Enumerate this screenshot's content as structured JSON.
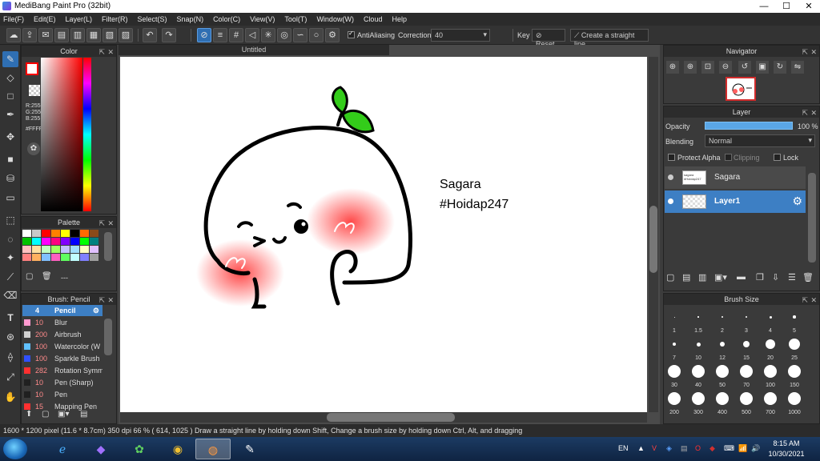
{
  "window": {
    "title": "MediBang Paint Pro (32bit)",
    "minimize": "—",
    "maximize": "☐",
    "close": "✕"
  },
  "menu": [
    "File(F)",
    "Edit(E)",
    "Layer(L)",
    "Filter(R)",
    "Select(S)",
    "Snap(N)",
    "Color(C)",
    "View(V)",
    "Tool(T)",
    "Window(W)",
    "Cloud",
    "Help"
  ],
  "toolbar": {
    "antialias_label": "AntiAliasing",
    "correction_label": "Correction",
    "correction_value": "40",
    "key_label": "Key",
    "reset_label": "Reset",
    "straight_line_label": "Create a straight line"
  },
  "color_panel": {
    "title": "Color",
    "r": "R:255",
    "g": "G:255",
    "b": "B:255",
    "hex": "#FFFFFF",
    "fg_color": "#ffffff",
    "fg_border": "#ff0000"
  },
  "palette_panel": {
    "title": "Palette",
    "dash": "---",
    "colors": [
      "#ffffff",
      "#c8c8c8",
      "#ff0000",
      "#ff8000",
      "#ffff00",
      "#000000",
      "#ff6a00",
      "#8a4a1a",
      "#00c000",
      "#00ffff",
      "#ff00ff",
      "#ff0080",
      "#8000ff",
      "#0000ff",
      "#00ff00",
      "#008080",
      "#ffc0c0",
      "#ffe0a0",
      "#c0ffc0",
      "#a0ff60",
      "#c0c0ff",
      "#a0e0ff",
      "#ffffc0",
      "#e0c0ff",
      "#ff8080",
      "#ffb060",
      "#80c0ff",
      "#ff60c0",
      "#60ff60",
      "#c0ffff",
      "#8080ff",
      "#a0a0a0"
    ]
  },
  "brush_panel": {
    "title": "Brush: Pencil",
    "items": [
      {
        "size": "4",
        "name": "Pencil",
        "color": "#3d7fc4"
      },
      {
        "size": "10",
        "name": "Blur",
        "color": "#ff9ad0"
      },
      {
        "size": "200",
        "name": "Airbrush",
        "color": "#d0d0d0"
      },
      {
        "size": "100",
        "name": "Watercolor (W",
        "color": "#60c0ff"
      },
      {
        "size": "100",
        "name": "Sparkle Brush",
        "color": "#3050ff"
      },
      {
        "size": "282",
        "name": "Rotation Symm",
        "color": "#ff3030"
      },
      {
        "size": "10",
        "name": "Pen (Sharp)",
        "color": "#202020"
      },
      {
        "size": "10",
        "name": "Pen",
        "color": "#202020"
      },
      {
        "size": "15",
        "name": "Mapping Pen",
        "color": "#ff3030"
      }
    ]
  },
  "document": {
    "tab_title": "Untitled",
    "text_line1": "Sagara",
    "text_line2": "#Hoidap247"
  },
  "navigator": {
    "title": "Navigator"
  },
  "layer_panel": {
    "title": "Layer",
    "opacity_label": "Opacity",
    "opacity_value": "100 %",
    "opacity_fraction": 1.0,
    "blending_label": "Blending",
    "blending_value": "Normal",
    "protect_alpha": "Protect Alpha",
    "clipping": "Clipping",
    "lock": "Lock",
    "layers": [
      {
        "name": "Sagara",
        "thumb_text": "sagara #Hoidap247",
        "selected": false
      },
      {
        "name": "Layer1",
        "selected": true
      }
    ]
  },
  "brush_size_panel": {
    "title": "Brush Size",
    "sizes": [
      "1",
      "1.5",
      "2",
      "3",
      "4",
      "5",
      "7",
      "10",
      "12",
      "15",
      "20",
      "25",
      "30",
      "40",
      "50",
      "70",
      "100",
      "150",
      "200",
      "300",
      "400",
      "500",
      "700",
      "1000"
    ]
  },
  "status": {
    "text": "1600 * 1200 pixel   (11.6 * 8.7cm)   350 dpi   66 %   ( 614, 1025 )   Draw a straight line by holding down Shift, Change a brush size by holding down Ctrl, Alt, and dragging"
  },
  "taskbar": {
    "lang": "EN",
    "time": "8:15 AM",
    "date": "10/30/2021"
  },
  "icons": [
    "brush-icon",
    "eraser-icon",
    "rectangle-icon",
    "pen-icon",
    "move-icon",
    "fill-icon",
    "bucket-icon",
    "gradient-icon",
    "select-rect-icon",
    "lasso-icon",
    "magic-wand-icon",
    "select-pen-icon",
    "select-eraser-icon",
    "text-icon",
    "operation-icon",
    "eyedropper-icon",
    "divide-icon",
    "hand-icon"
  ]
}
